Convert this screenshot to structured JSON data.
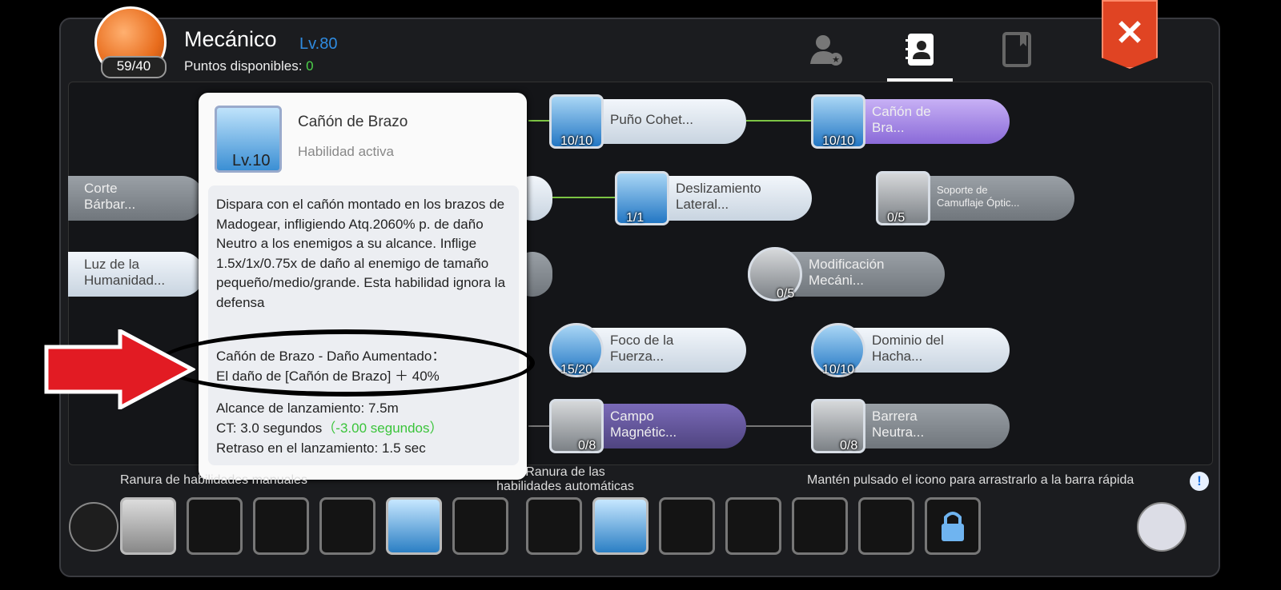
{
  "header": {
    "class_name": "Mecánico",
    "level": "Lv.80",
    "points_label": "Puntos disponibles: ",
    "points_value": "0",
    "avatar_count": "59/40"
  },
  "tabs": [
    {
      "icon": "user-star-icon"
    },
    {
      "icon": "contact-book-icon",
      "active": true
    },
    {
      "icon": "book-icon"
    }
  ],
  "close_label": "✕",
  "skills": [
    {
      "name": "Puño Cohet...",
      "count": "10/10"
    },
    {
      "name": "Cañón de\nBra...",
      "count": "10/10"
    },
    {
      "name": "Corte\nBárbar...",
      "count": ""
    },
    {
      "name": "Deslizamiento\nLateral...",
      "count": "1/1"
    },
    {
      "name": "Soporte de\nCamuflaje Óptic...",
      "count": "0/5"
    },
    {
      "name": "Luz de la\nHumanidad...",
      "count": ""
    },
    {
      "name": "Modificación\nMecáni...",
      "count": "0/5"
    },
    {
      "name": "Foco de la\nFuerza...",
      "count": "15/20"
    },
    {
      "name": "Dominio del\nHacha...",
      "count": "10/10"
    },
    {
      "name": "Campo\nMagnétic...",
      "count": "0/8"
    },
    {
      "name": "Barrera\nNeutra...",
      "count": "0/8"
    }
  ],
  "tooltip": {
    "level": "Lv.10",
    "name": "Cañón de Brazo",
    "type": "Habilidad activa",
    "description": "Dispara con el cañón montado en los brazos de Madogear, infligiendo Atq.2060% p. de daño Neutro a los enemigos a su alcance. Inflige 1.5x/1x/0.75x de daño al enemigo de tamaño pequeño/medio/grande. Esta habilidad ignora la defensa",
    "bonus_line1": "Cañón de Brazo - Daño Aumentado：",
    "bonus_line2": "El daño de [Cañón de Brazo] ＋ 40%",
    "range": "Alcance de lanzamiento: 7.5m",
    "ct": "CT: 3.0 segundos",
    "ct_bonus": "（-3.00 segundos）",
    "delay": "Retraso en el lanzamiento: 1.5 sec"
  },
  "bottom": {
    "manual_label": "Ranura de habilidades manuales",
    "auto_label_1": "Ranura de las",
    "auto_label_2": "habilidades automáticas",
    "hint": "Mantén pulsado el icono para arrastrarlo a la barra rápida",
    "info_icon": "!"
  },
  "colors": {
    "accent": "#2f8be0",
    "close": "#e04423",
    "green": "#3ac43a"
  }
}
